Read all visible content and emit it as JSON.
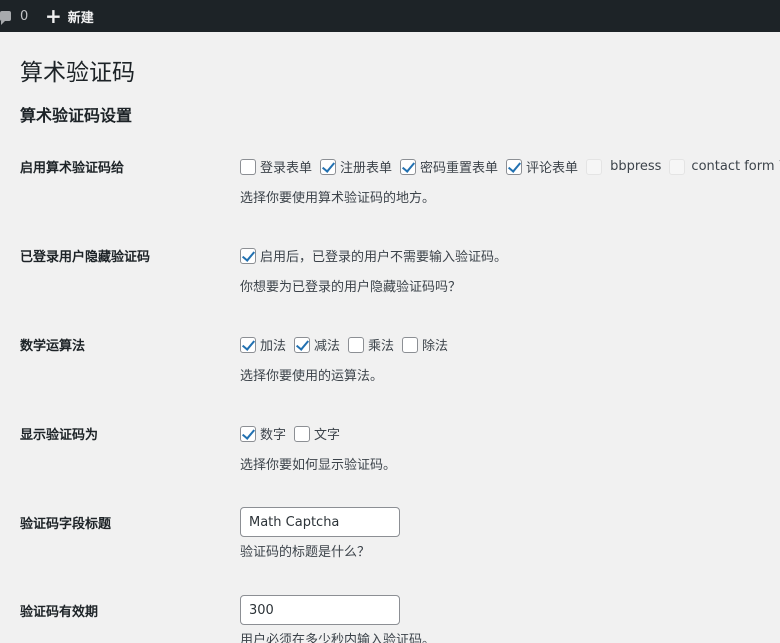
{
  "admin_bar": {
    "comments_count": "0",
    "new_label": "新建"
  },
  "page": {
    "title": "算术验证码",
    "section_title": "算术验证码设置"
  },
  "settings": {
    "enable_for": {
      "label": "启用算术验证码给",
      "options": [
        {
          "label": "登录表单",
          "checked": false
        },
        {
          "label": "注册表单",
          "checked": true
        },
        {
          "label": "密码重置表单",
          "checked": true
        },
        {
          "label": "评论表单",
          "checked": true
        },
        {
          "label": "bbpress",
          "checked": false,
          "disabled": true
        },
        {
          "label": "contact form 7",
          "checked": false,
          "disabled": true
        }
      ],
      "description": "选择你要使用算术验证码的地方。"
    },
    "hide_logged_in": {
      "label": "已登录用户隐藏验证码",
      "option_label": "启用后，已登录的用户不需要输入验证码。",
      "checked": true,
      "description": "你想要为已登录的用户隐藏验证码吗？"
    },
    "operations": {
      "label": "数学运算法",
      "options": [
        {
          "label": "加法",
          "checked": true
        },
        {
          "label": "减法",
          "checked": true
        },
        {
          "label": "乘法",
          "checked": false
        },
        {
          "label": "除法",
          "checked": false
        }
      ],
      "description": "选择你要使用的运算法。"
    },
    "display_as": {
      "label": "显示验证码为",
      "options": [
        {
          "label": "数字",
          "checked": true
        },
        {
          "label": "文字",
          "checked": false
        }
      ],
      "description": "选择你要如何显示验证码。"
    },
    "field_title": {
      "label": "验证码字段标题",
      "value": "Math Captcha",
      "description": "验证码的标题是什么？"
    },
    "expiry": {
      "label": "验证码有效期",
      "value": "300",
      "description": "用户必须在多少秒内输入验证码。"
    }
  }
}
